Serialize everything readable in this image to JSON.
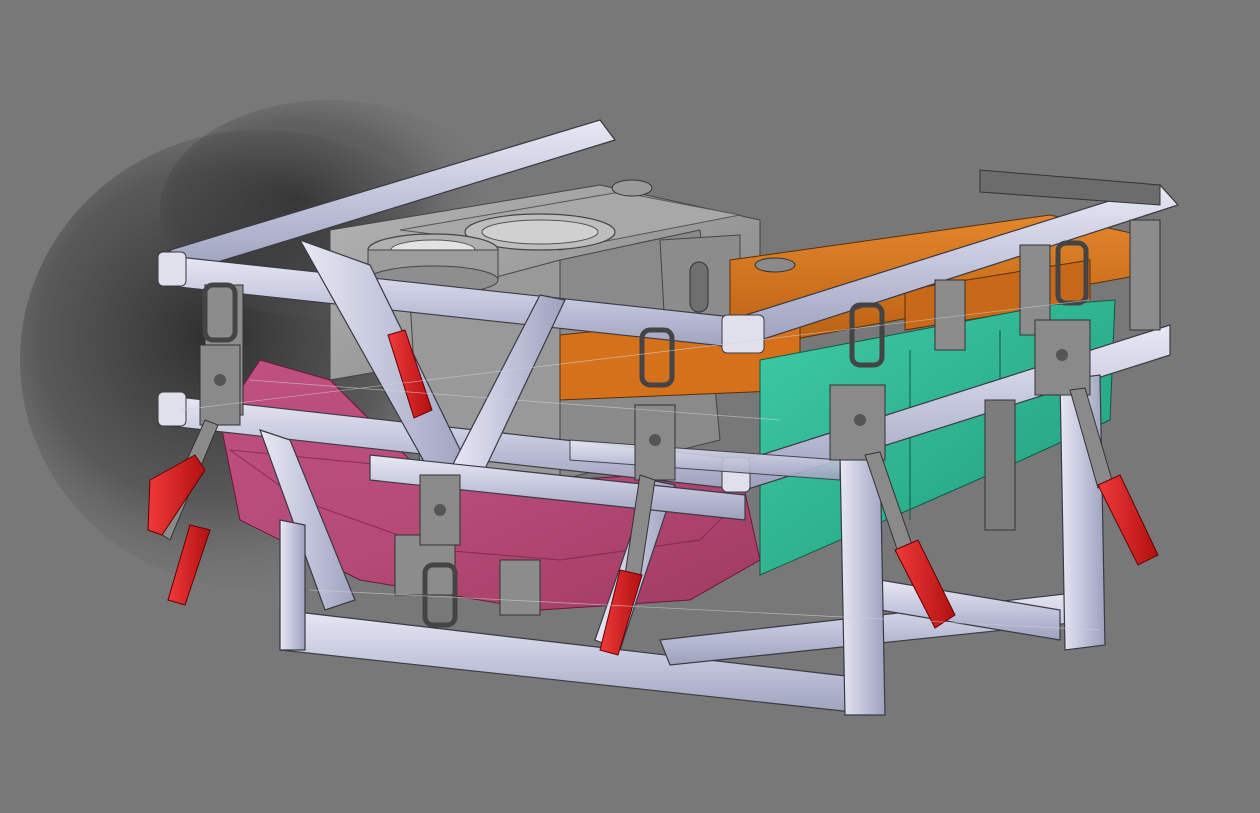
{
  "scene": {
    "background": "#787878",
    "shadow_color": "#2a2a2a",
    "frame_fill": "#c9cbe0",
    "frame_edge": "#3a3a44",
    "frame_highlight": "#e6e7f2",
    "gray_part": "#9a9a9a",
    "gray_dark": "#6c6c6c",
    "orange_part": "#d8741e",
    "green_part": "#2bb592",
    "pink_part": "#c8407a",
    "clamp_metal": "#8a8a8a",
    "clamp_handle": "#e01b1b",
    "icon_names": [
      "toggle-clamp-icon"
    ]
  }
}
